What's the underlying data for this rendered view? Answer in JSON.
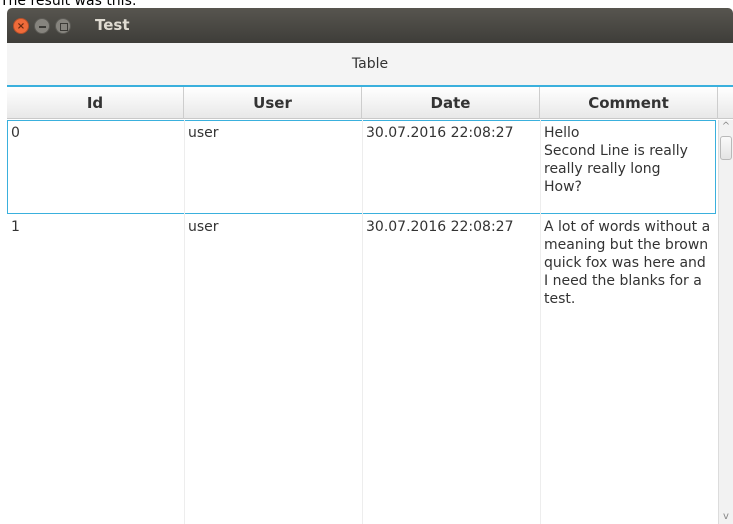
{
  "caption": "The result was this:",
  "window": {
    "title": "Test",
    "close_glyph": "×",
    "min_glyph": "",
    "max_glyph": ""
  },
  "table_label": "Table",
  "columns": [
    "Id",
    "User",
    "Date",
    "Comment"
  ],
  "rows": [
    {
      "id": "0",
      "user": "user",
      "date": "30.07.2016 22:08:27",
      "comment": "Hello\nSecond Line is really really really long\nHow?",
      "selected": true
    },
    {
      "id": "1",
      "user": "user",
      "date": "30.07.2016 22:08:27",
      "comment": "A lot of words without a meaning but the brown quick fox was here and I need the blanks for a test.",
      "selected": false
    }
  ],
  "scrollbar": {
    "up_glyph": "^",
    "down_glyph": "v"
  },
  "colors": {
    "accent": "#3ab0dd",
    "titlebar": "#4a4944",
    "close": "#ef6b3a"
  }
}
